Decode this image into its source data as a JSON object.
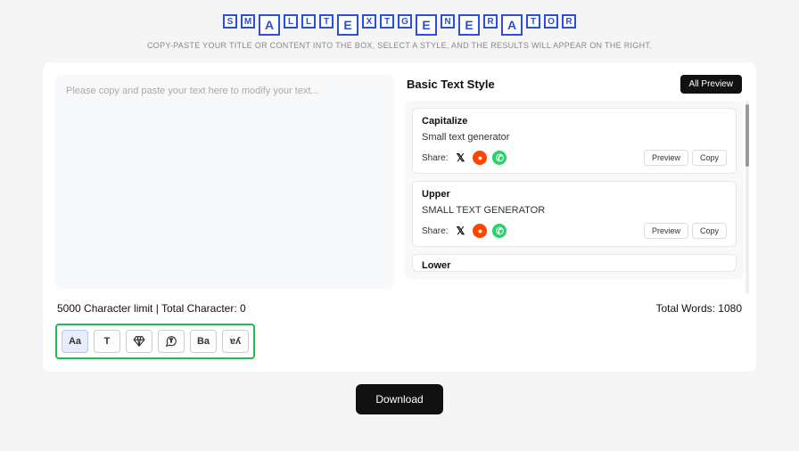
{
  "header": {
    "logo_letters": [
      "S",
      "M",
      "A",
      "L",
      "L",
      "T",
      "E",
      "X",
      "T",
      "G",
      "E",
      "N",
      "E",
      "R",
      "A",
      "T",
      "O",
      "R"
    ],
    "logo_big_indices": [
      2,
      6,
      10,
      12,
      14
    ],
    "subtitle": "COPY-PASTE YOUR TITLE OR CONTENT INTO THE BOX, SELECT A STYLE, AND THE RESULTS WILL APPEAR ON THE RIGHT."
  },
  "input": {
    "placeholder": "Please copy and paste your text here to modify your text...",
    "value": ""
  },
  "output": {
    "title": "Basic Text Style",
    "all_preview_label": "All Preview",
    "share_label": "Share:",
    "preview_label": "Preview",
    "copy_label": "Copy",
    "styles": [
      {
        "name": "Capitalize",
        "output": "Small text generator"
      },
      {
        "name": "Upper",
        "output": "SMALL TEXT GENERATOR"
      },
      {
        "name": "Lower",
        "output": ""
      }
    ]
  },
  "stats": {
    "char_limit_text": "5000 Character limit | Total Character: 0",
    "total_words_text": "Total Words: 1080"
  },
  "toolbar": {
    "items": [
      {
        "name": "case-tool",
        "label": "Aa",
        "active": true
      },
      {
        "name": "text-tool",
        "label": "T",
        "active": false
      },
      {
        "name": "diamond-tool",
        "label": "diamond",
        "active": false
      },
      {
        "name": "bubble-tool",
        "label": "bubble",
        "active": false
      },
      {
        "name": "bold-tool",
        "label": "Ba",
        "active": false
      },
      {
        "name": "flip-tool",
        "label": "ɐʎ",
        "active": false
      }
    ]
  },
  "download": {
    "label": "Download"
  },
  "colors": {
    "brand": "#2c4fd7",
    "highlight": "#1fbb57",
    "dark": "#111111"
  }
}
